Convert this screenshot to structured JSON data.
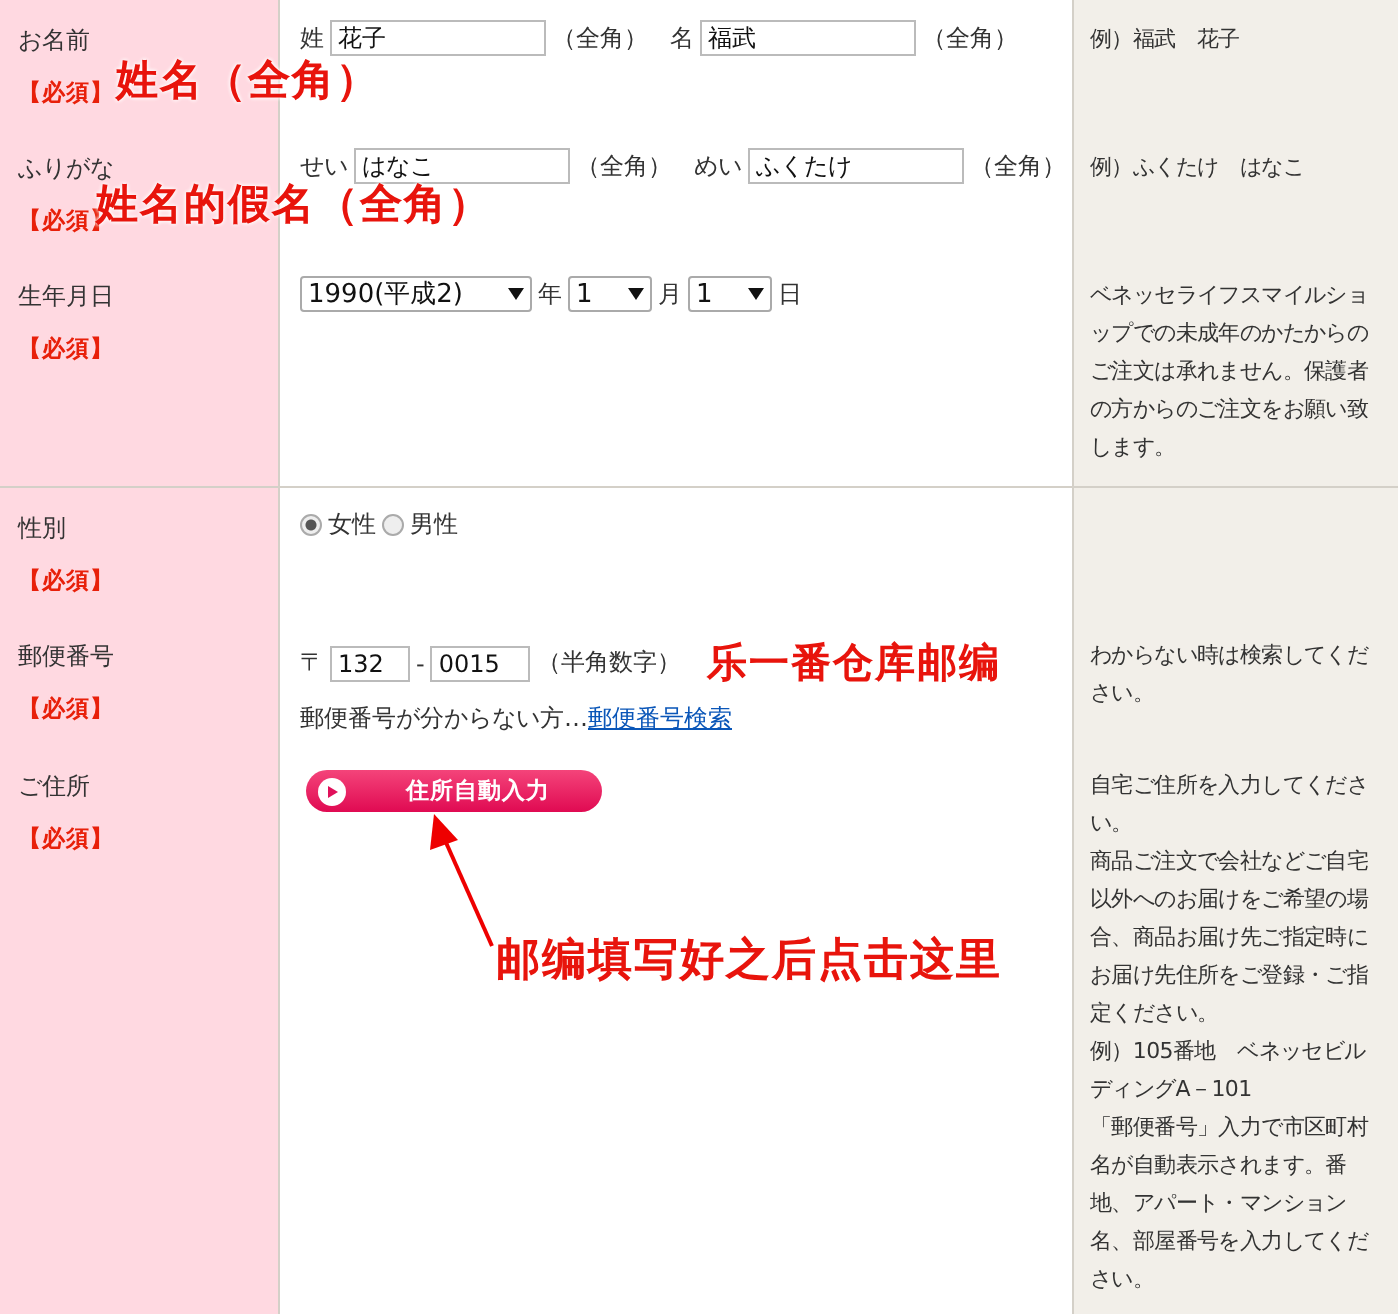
{
  "rows": [
    {
      "kind": "name",
      "label": "お名前",
      "required": "【必須】",
      "fields": [
        {
          "prefix": "姓",
          "value": "花子",
          "suffix": "（全角）"
        },
        {
          "prefix": "名",
          "value": "福武",
          "suffix": "（全角）"
        }
      ],
      "annotation": "姓名（全角）",
      "help": [
        "例）福武　花子"
      ]
    },
    {
      "kind": "name",
      "label": "ふりがな",
      "required": "【必須】",
      "fields": [
        {
          "prefix": "せい",
          "value": "はなこ",
          "suffix": "（全角）"
        },
        {
          "prefix": "めい",
          "value": "ふくたけ",
          "suffix": "（全角）"
        }
      ],
      "annotation": "姓名的假名（全角）",
      "help": [
        "例）ふくたけ　はなこ"
      ]
    },
    {
      "kind": "date",
      "label": "生年月日",
      "required": "【必須】",
      "selects": [
        {
          "value": "1990(平成2)",
          "suffix": "年"
        },
        {
          "value": "1",
          "suffix": "月"
        },
        {
          "value": "1",
          "suffix": "日"
        }
      ],
      "help": [
        "ベネッセライフスマイルショップでの未成年のかたからのご注文は承れません。保護者の方からのご注文をお願い致します。"
      ]
    },
    {
      "kind": "radio",
      "label": "性別",
      "required": "【必須】",
      "options": [
        {
          "label": "女性",
          "selected": true
        },
        {
          "label": "男性",
          "selected": false
        }
      ]
    },
    {
      "kind": "postal",
      "label": "郵便番号",
      "required": "【必須】",
      "mark": "〒",
      "parts": [
        "132",
        "0015"
      ],
      "separator": "-",
      "suffix": "（半角数字）",
      "annotation": "乐一番仓库邮编",
      "note": "郵便番号が分からない方…",
      "link": "郵便番号検索",
      "help": [
        "わからない時は検索してください。"
      ]
    },
    {
      "kind": "address",
      "label": "ご住所",
      "required": "【必須】",
      "button": "住所自動入力",
      "annotation": "邮编填写好之后点击这里",
      "help": [
        "自宅ご住所を入力してください。",
        "商品ご注文で会社などご自宅以外へのお届けをご希望の場合、商品お届け先ご指定時にお届け先住所をご登録・ご指定ください。",
        "例）105番地　ベネッセビルディングA－101",
        "「郵便番号」入力で市区町村名が自動表示されます。番地、アパート・マンション名、部屋番号を入力してください。"
      ]
    }
  ]
}
